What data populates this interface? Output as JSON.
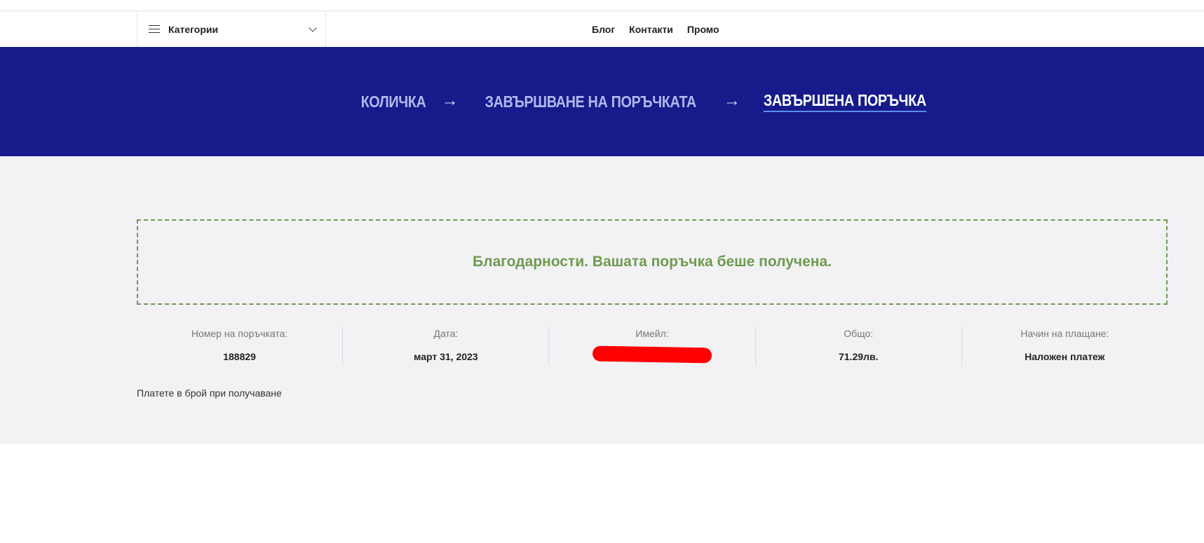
{
  "header": {
    "categories_label": "Категории",
    "nav": [
      "Блог",
      "Контакти",
      "Промо"
    ]
  },
  "breadcrumb": {
    "steps": [
      "КОЛИЧКА",
      "ЗАВЪРШВАНЕ НА ПОРЪЧКАТА",
      "ЗАВЪРШЕНА ПОРЪЧКА"
    ],
    "arrow": "→",
    "active_index": 2
  },
  "notice": {
    "text": "Благодарности. Вашата поръчка беше получена."
  },
  "order_overview": {
    "order_number_label": "Номер на поръчката:",
    "order_number": "188829",
    "date_label": "Дата:",
    "date": "март 31, 2023",
    "email_label": "Имейл:",
    "total_label": "Общо:",
    "total": "71.29лв.",
    "payment_label": "Начин на плащане:",
    "payment": "Наложен платеж"
  },
  "payment_note": "Платете в брой при получаване",
  "colors": {
    "banner": "#161a8a",
    "success": "#6f9a4e",
    "redaction": "#ff0000"
  }
}
